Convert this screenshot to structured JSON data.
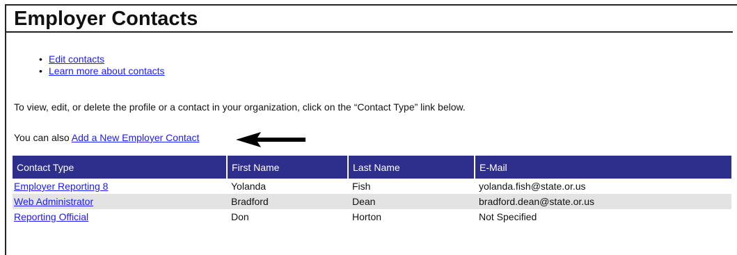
{
  "page": {
    "title": "Employer Contacts"
  },
  "links": [
    {
      "bullet": "•",
      "label": "Edit contacts"
    },
    {
      "bullet": "•",
      "label": "Learn more about contacts"
    }
  ],
  "intro_text": "To view, edit, or delete the profile or a contact in your organization, click on the “Contact Type” link below.",
  "add_line": {
    "prefix": "You can also ",
    "link_label": "Add a New Employer Contact"
  },
  "table": {
    "headers": [
      "Contact Type",
      "First Name",
      "Last Name",
      "E-Mail"
    ],
    "rows": [
      {
        "contact_type": "Employer Reporting 8",
        "first_name": "Yolanda",
        "last_name": "Fish",
        "email": "yolanda.fish@state.or.us"
      },
      {
        "contact_type": "Web Administrator",
        "first_name": "Bradford",
        "last_name": "Dean",
        "email": "bradford.dean@state.or.us"
      },
      {
        "contact_type": "Reporting Official",
        "first_name": "Don",
        "last_name": "Horton",
        "email": "Not Specified"
      }
    ]
  },
  "colors": {
    "header_bg": "#2e2e8c",
    "link": "#1a1aff",
    "alt_row": "#e3e3e3"
  },
  "icons": {
    "annotation_arrow": "left-arrow-icon"
  }
}
